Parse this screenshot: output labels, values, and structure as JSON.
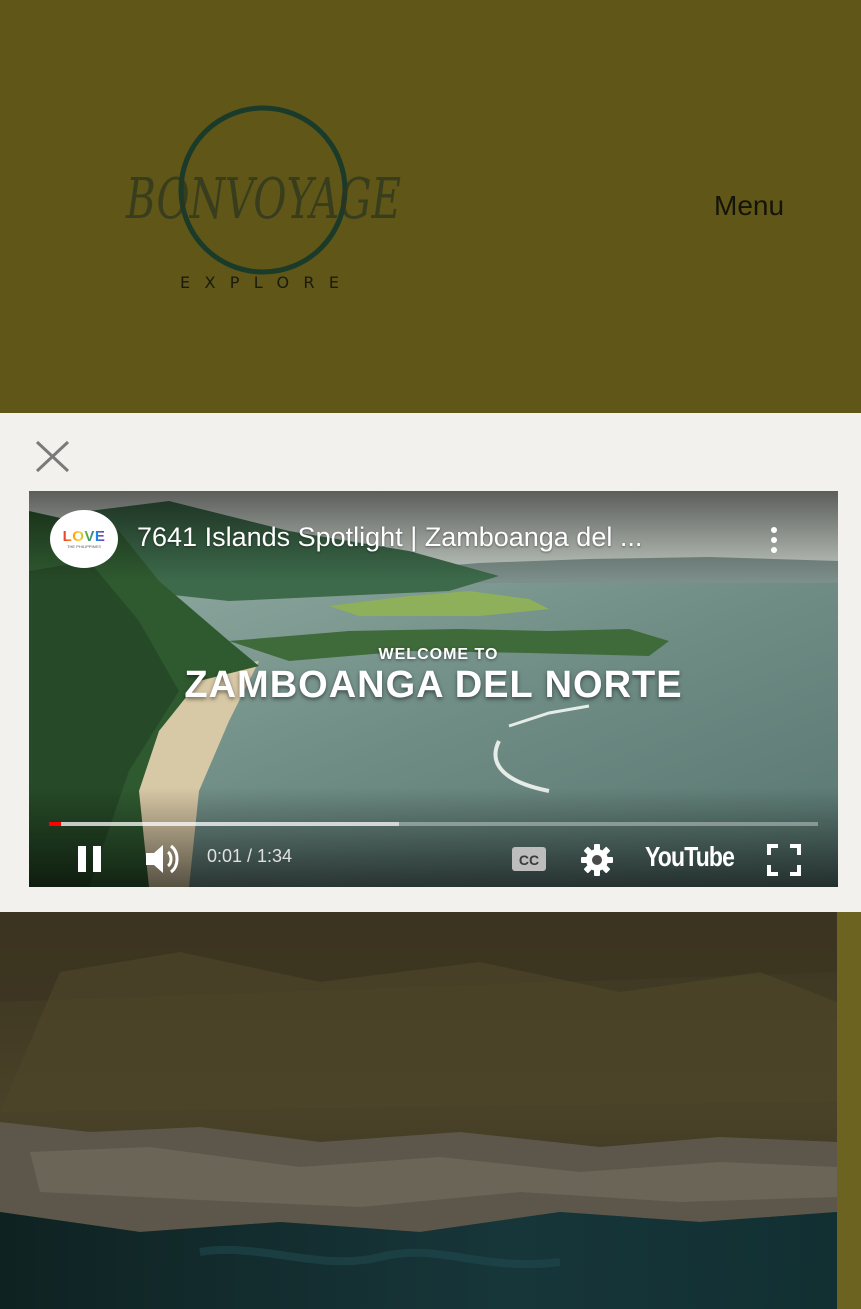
{
  "header": {
    "logo": {
      "text": "BONVOYAGE",
      "subtext": "EXPLORE"
    },
    "menu_label": "Menu"
  },
  "video": {
    "channel_avatar": {
      "text": "LOVE",
      "subtext": "THE PHILIPPINES"
    },
    "title": "7641 Islands Spotlight | Zamboanga del ...",
    "overlay_small": "WELCOME TO",
    "overlay_big": "ZAMBOANGA DEL NORTE",
    "time": "0:01 / 1:34",
    "progress_played_fraction": 0.015,
    "progress_buffered_fraction": 0.455,
    "brand": "YouTube",
    "icons": [
      "close-icon",
      "more-options-icon",
      "pause-icon",
      "volume-icon",
      "captions-icon",
      "settings-icon",
      "fullscreen-icon"
    ]
  },
  "colors": {
    "header_bg": "#5f5617",
    "modal_bg": "#f2f1ee",
    "progress_red": "#ff0000"
  }
}
